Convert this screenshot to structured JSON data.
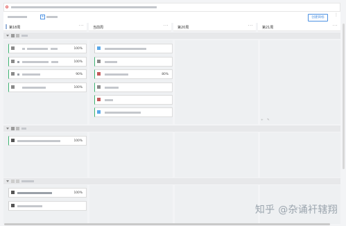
{
  "tip": {
    "text": ""
  },
  "toolbar": {
    "scope_select": "",
    "new_plan_label": "",
    "goal_button_label": "创建目标",
    "more_icon": "more-vertical-icon"
  },
  "columns": [
    {
      "title": "第18周"
    },
    {
      "title": "当前周"
    },
    {
      "title": "第20周"
    },
    {
      "title": "第21周"
    }
  ],
  "groups": [
    {
      "label": ""
    },
    {
      "label": ""
    },
    {
      "label": ""
    }
  ],
  "group1": {
    "col1_cards": [
      {
        "title": "",
        "progress": "100%"
      },
      {
        "title": "",
        "progress": "100%"
      },
      {
        "title": "",
        "progress": "90%"
      },
      {
        "title": "",
        "progress": "100%"
      }
    ],
    "col2_cards": [
      {
        "title": "",
        "progress": ""
      },
      {
        "title": "",
        "progress": ""
      },
      {
        "title": "",
        "progress": "80%"
      },
      {
        "title": "",
        "progress": ""
      },
      {
        "title": "",
        "progress": ""
      },
      {
        "title": "",
        "progress": ""
      }
    ]
  },
  "group2": {
    "col1_cards": [
      {
        "title": "",
        "progress": "100%"
      }
    ]
  },
  "group3": {
    "col1_cards": [
      {
        "title": "",
        "progress": "100%"
      },
      {
        "title": "",
        "progress": ""
      }
    ]
  },
  "watermark": "知乎 @杂诵衦辖翔",
  "colors": {
    "accent": "#4a90e2",
    "card_border_active": "#3cb371",
    "background": "#f3f4f6"
  }
}
